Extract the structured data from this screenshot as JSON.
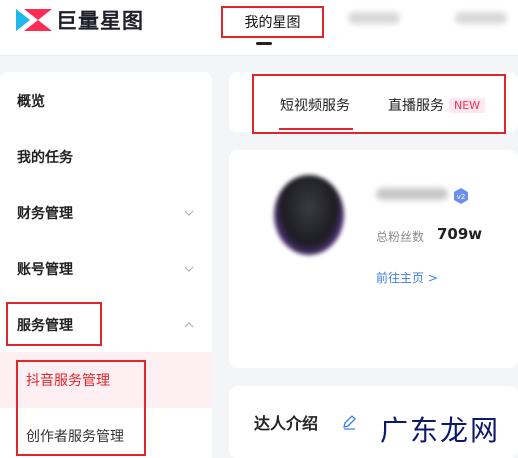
{
  "header": {
    "logo_text": "巨量星图",
    "active_tab": "我的星图"
  },
  "sidebar": {
    "items": [
      {
        "label": "概览"
      },
      {
        "label": "我的任务"
      },
      {
        "label": "财务管理"
      },
      {
        "label": "账号管理"
      },
      {
        "label": "服务管理"
      }
    ],
    "sub_items": [
      {
        "label": "抖音服务管理"
      },
      {
        "label": "创作者服务管理"
      }
    ]
  },
  "service_tabs": {
    "tab1": "短视频服务",
    "tab2": "直播服务",
    "tab2_badge": "NEW"
  },
  "profile": {
    "fans_label": "总粉丝数",
    "fans_value": "709w",
    "home_link": "前往主页 >"
  },
  "intro": {
    "title": "达人介绍"
  },
  "watermark": "广东龙网",
  "colors": {
    "accent": "#e0262d",
    "link": "#3c7ee6",
    "badge": "#fe2c55"
  }
}
